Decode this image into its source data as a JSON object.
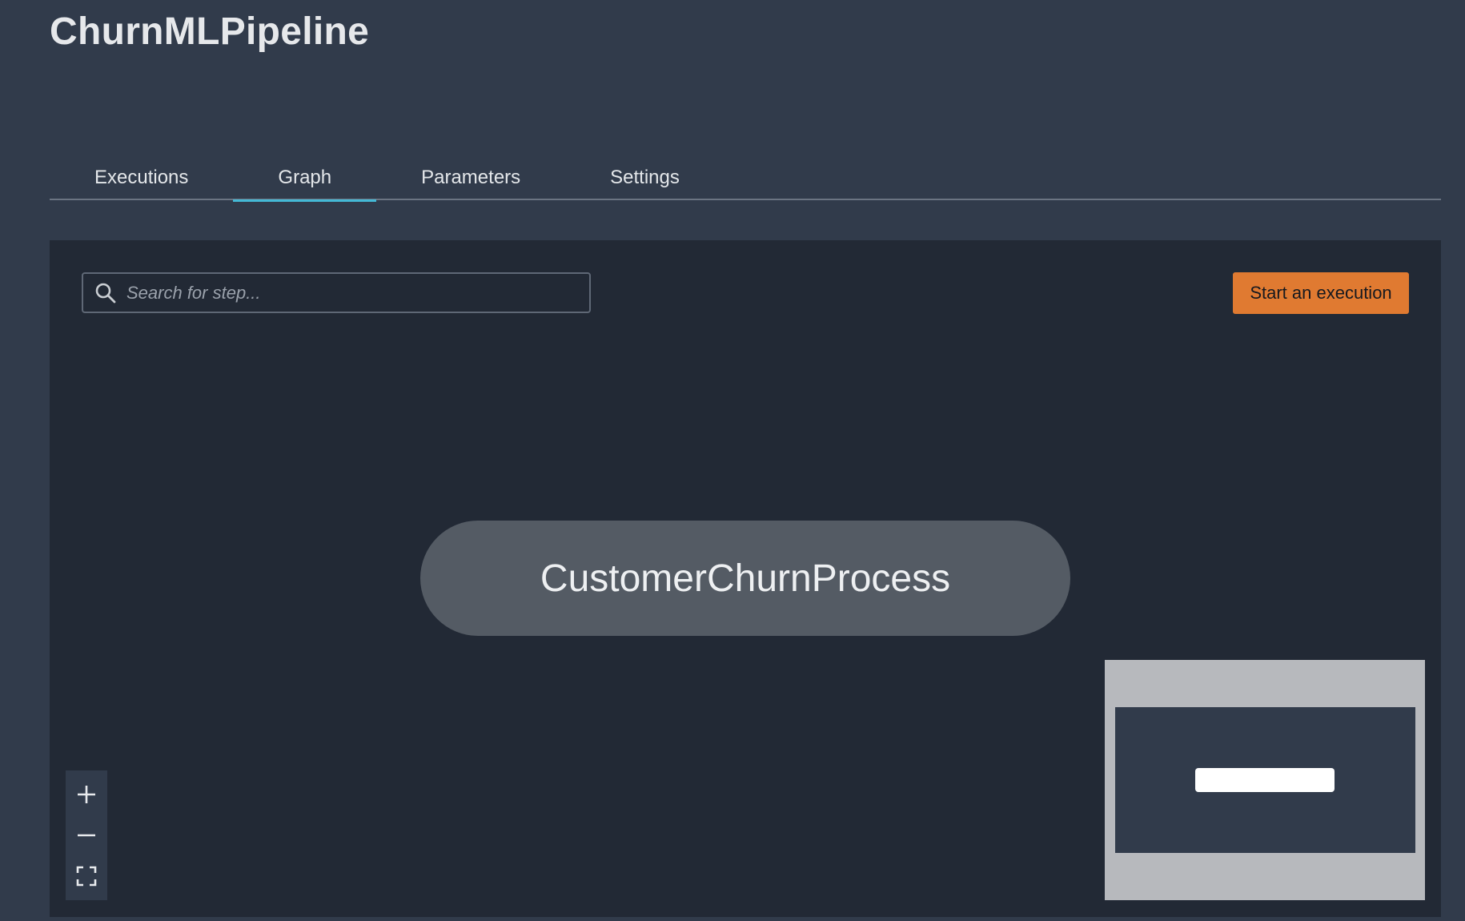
{
  "page": {
    "title": "ChurnMLPipeline"
  },
  "tabs": [
    {
      "label": "Executions",
      "active": false
    },
    {
      "label": "Graph",
      "active": true
    },
    {
      "label": "Parameters",
      "active": false
    },
    {
      "label": "Settings",
      "active": false
    }
  ],
  "toolbar": {
    "search_placeholder": "Search for step...",
    "search_value": "",
    "start_label": "Start an execution"
  },
  "graph": {
    "nodes": [
      {
        "label": "CustomerChurnProcess"
      }
    ]
  },
  "icons": {
    "search": "search-icon",
    "zoom_in": "plus-icon",
    "zoom_out": "minus-icon",
    "fit": "fit-to-screen-icon"
  },
  "colors": {
    "accent_button": "#e07a31",
    "active_tab_underline": "#44b9d6",
    "node_fill": "#545b64",
    "canvas_bg": "#222935",
    "page_bg": "#313b4b"
  }
}
